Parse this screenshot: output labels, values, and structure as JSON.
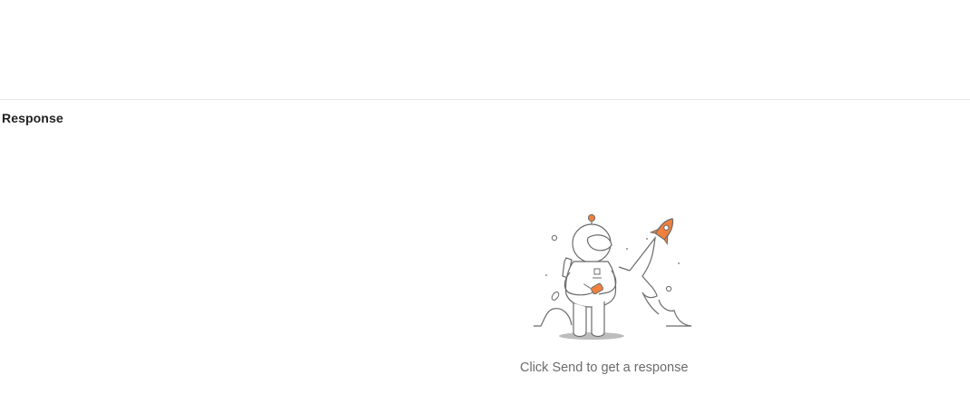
{
  "response_panel": {
    "title": "Response",
    "empty_state": {
      "illustration": "astronaut-rocket-illustration",
      "message": "Click Send to get a response"
    }
  },
  "colors": {
    "accent": "#f0803c",
    "line": "#6b6b6b",
    "text_primary": "#212121",
    "text_muted": "#6b6b6b",
    "divider": "#e6e6e6"
  }
}
